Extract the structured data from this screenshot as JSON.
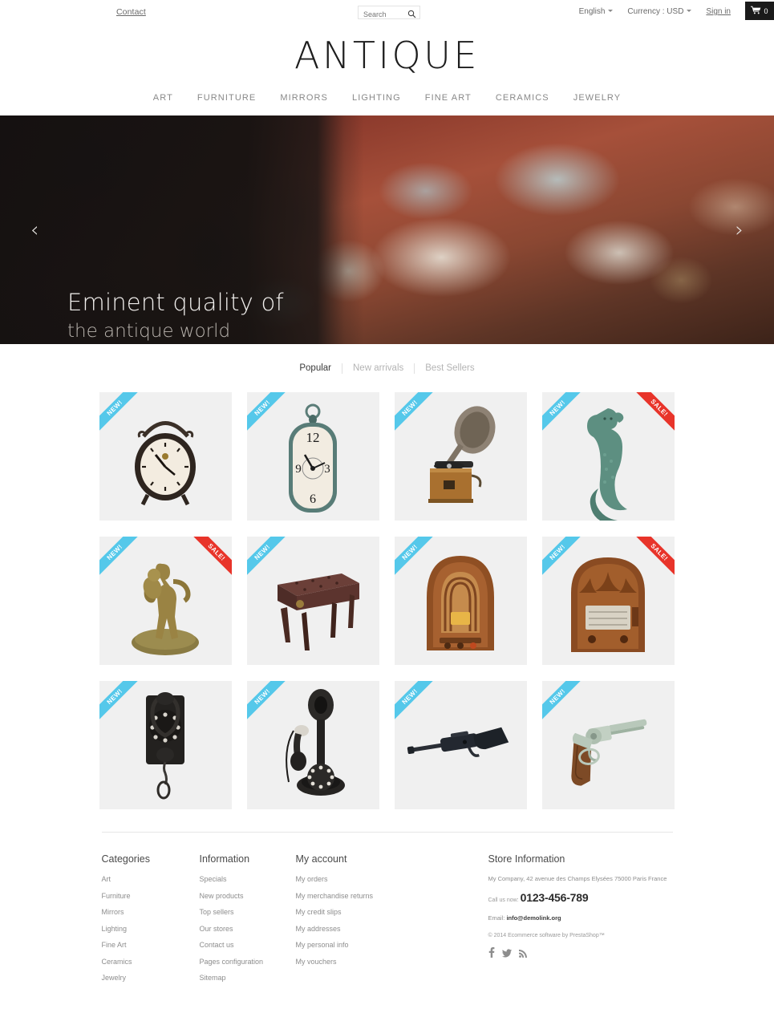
{
  "topbar": {
    "contact": "Contact",
    "search_placeholder": "Search",
    "search_value": "",
    "language": "English",
    "currency": "Currency : USD",
    "signin": "Sign in",
    "cart_count": "0"
  },
  "header": {
    "logo": "ANTIQUE",
    "nav": [
      {
        "label": "ART"
      },
      {
        "label": "FURNITURE"
      },
      {
        "label": "MIRRORS"
      },
      {
        "label": "LIGHTING"
      },
      {
        "label": "FINE ART"
      },
      {
        "label": "CERAMICS"
      },
      {
        "label": "JEWELRY"
      }
    ]
  },
  "hero": {
    "line1": "Eminent quality of",
    "line2": "the antique world",
    "prev": "‹",
    "next": "›"
  },
  "tabs": [
    {
      "label": "Popular",
      "active": true
    },
    {
      "label": "New arrivals",
      "active": false
    },
    {
      "label": "Best Sellers",
      "active": false
    }
  ],
  "products": [
    {
      "name": "mantel-clock",
      "badges": [
        "NEW!"
      ]
    },
    {
      "name": "wall-clock",
      "badges": [
        "NEW!"
      ]
    },
    {
      "name": "gramophone",
      "badges": [
        "NEW!"
      ]
    },
    {
      "name": "mermaid-figurine",
      "badges": [
        "NEW!",
        "SALE!"
      ]
    },
    {
      "name": "bronze-statue",
      "badges": [
        "NEW!",
        "SALE!"
      ]
    },
    {
      "name": "leather-stool",
      "badges": [
        "NEW!"
      ]
    },
    {
      "name": "cathedral-radio",
      "badges": [
        "NEW!"
      ]
    },
    {
      "name": "tombstone-radio",
      "badges": [
        "NEW!",
        "SALE!"
      ]
    },
    {
      "name": "wall-telephone",
      "badges": [
        "NEW!"
      ]
    },
    {
      "name": "candlestick-phone",
      "badges": [
        "NEW!"
      ]
    },
    {
      "name": "air-rifle",
      "badges": [
        "NEW!"
      ]
    },
    {
      "name": "revolver",
      "badges": [
        "NEW!"
      ]
    }
  ],
  "footer": {
    "categories": {
      "title": "Categories",
      "links": [
        "Art",
        "Furniture",
        "Mirrors",
        "Lighting",
        "Fine Art",
        "Ceramics",
        "Jewelry"
      ]
    },
    "information": {
      "title": "Information",
      "links": [
        "Specials",
        "New products",
        "Top sellers",
        "Our stores",
        "Contact us",
        "Pages configuration",
        "Sitemap"
      ]
    },
    "account": {
      "title": "My account",
      "links": [
        "My orders",
        "My merchandise returns",
        "My credit slips",
        "My addresses",
        "My personal info",
        "My vouchers"
      ]
    },
    "store": {
      "title": "Store Information",
      "address": "My Company, 42 avenue des Champs Elysées 75000 Paris France",
      "phone_label": "Call us now:",
      "phone": "0123-456-789",
      "email_label": "Email:",
      "email": "info@demolink.org",
      "copyright": "© 2014 Ecommerce software by PrestaShop™",
      "socials": [
        "facebook-icon",
        "twitter-icon",
        "rss-icon"
      ]
    }
  },
  "colors": {
    "new_badge": "#55c8ea",
    "sale_badge": "#e8342a",
    "cart_bg": "#1a1a1a",
    "tile_bg": "#f0f0f0"
  }
}
